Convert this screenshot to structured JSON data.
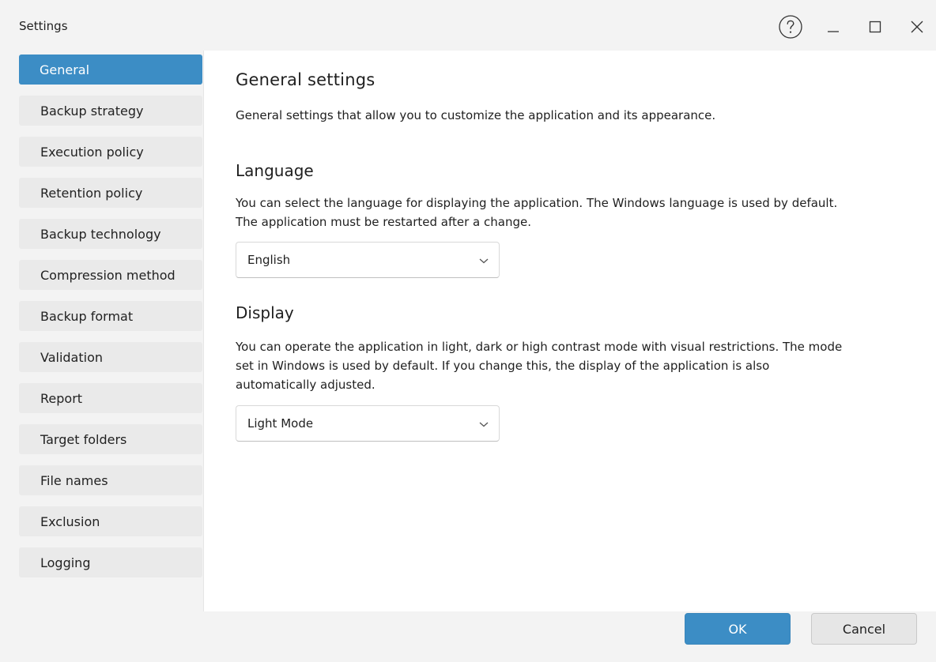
{
  "window": {
    "title": "Settings"
  },
  "titlebar_icons": [
    "help-icon",
    "minimize-icon",
    "maximize-icon",
    "close-icon"
  ],
  "sidebar": {
    "items": [
      {
        "label": "General",
        "active": true
      },
      {
        "label": "Backup strategy"
      },
      {
        "label": "Execution policy"
      },
      {
        "label": "Retention policy"
      },
      {
        "label": "Backup technology"
      },
      {
        "label": "Compression method"
      },
      {
        "label": "Backup format"
      },
      {
        "label": "Validation"
      },
      {
        "label": "Report"
      },
      {
        "label": "Target folders"
      },
      {
        "label": "File names"
      },
      {
        "label": "Exclusion"
      },
      {
        "label": "Logging"
      }
    ]
  },
  "main": {
    "title": "General settings",
    "description": "General settings that allow you to customize the application and its appearance.",
    "language": {
      "heading": "Language",
      "text_line1": "You can select the language for displaying the application. The Windows language is used by default.",
      "text_line2": "The application must be restarted after a change.",
      "selected": "English"
    },
    "display": {
      "heading": "Display",
      "text_line1": "You can operate the application in light, dark or high contrast mode with visual restrictions. The mode",
      "text_line2": "set in Windows is used by default. If you change this, the display of the application is also",
      "text_line3": "automatically adjusted.",
      "selected": "Light Mode"
    }
  },
  "footer": {
    "ok_label": "OK",
    "cancel_label": "Cancel"
  },
  "colors": {
    "accent": "#3c8dc5",
    "window_bg": "#f3f3f3",
    "content_bg": "#ffffff",
    "nav_bg": "#eaeaea"
  }
}
